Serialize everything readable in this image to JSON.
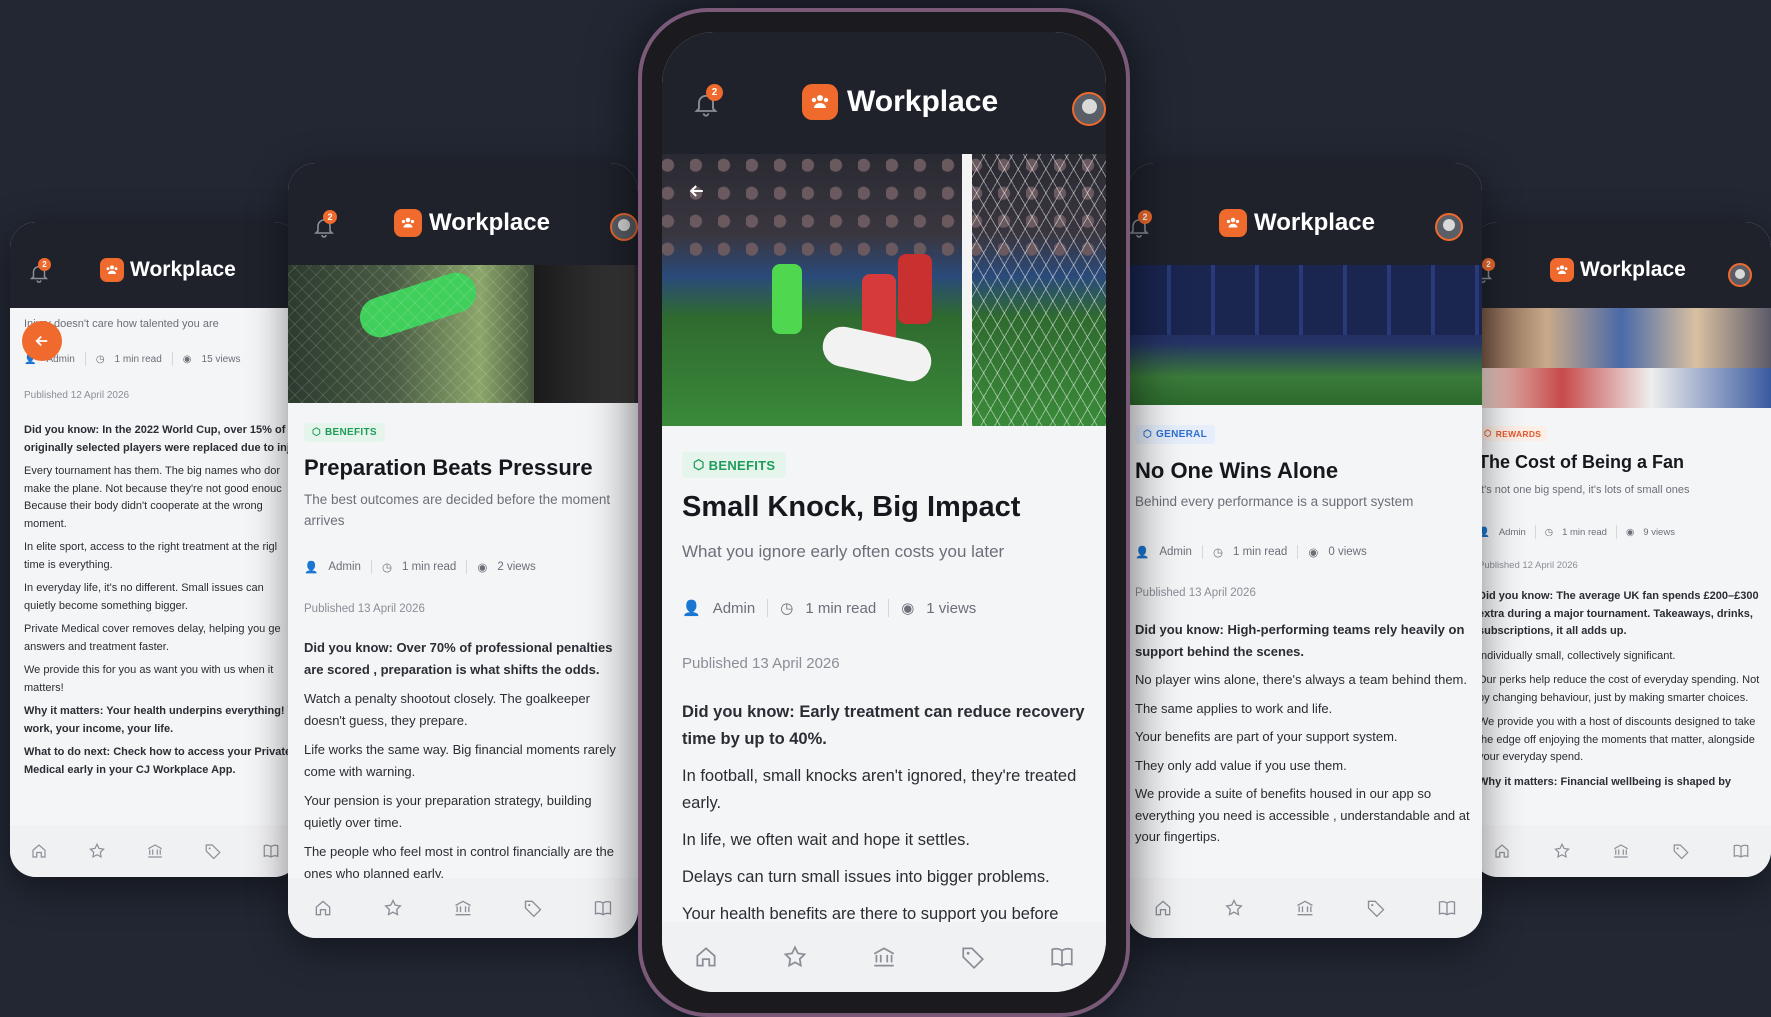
{
  "app_name": "Workplace",
  "notification_count": "2",
  "phones": {
    "p1": {
      "intro": "Injury doesn't care how talented you are",
      "author": "Admin",
      "read": "1 min read",
      "views": "15 views",
      "published": "Published 12 April 2026",
      "paras": [
        {
          "text": "Did you know: In the 2022 World Cup, over 15% of originally selected players were replaced due to inj",
          "bold": true
        },
        {
          "text": "Every tournament has them. The big names who dor make the plane. Not because they're not good enouc Because their body didn't cooperate at the wrong moment.",
          "bold": false
        },
        {
          "text": "In elite sport, access to the right treatment at the rigl time is everything.",
          "bold": false
        },
        {
          "text": "In everyday life, it's no different. Small issues can quietly become something bigger.",
          "bold": false
        },
        {
          "text": "Private Medical cover removes delay, helping you ge answers and treatment faster.",
          "bold": false
        },
        {
          "text": "We provide this for you as want you with us when it matters!",
          "bold": false
        },
        {
          "text": "Why it matters: Your health underpins everything! Y work, your income, your life.",
          "bold": true
        },
        {
          "text": "What to do next: Check how to access your Private Medical early in your CJ Workplace App.",
          "bold": true
        }
      ]
    },
    "p2": {
      "tag": "BENEFITS",
      "title": "Preparation Beats Pressure",
      "subtitle": "The best outcomes are decided before the moment arrives",
      "author": "Admin",
      "read": "1 min read",
      "views": "2 views",
      "published": "Published 13 April 2026",
      "paras": [
        {
          "text": "Did you know: Over 70% of professional penalties are scored , preparation is what shifts the odds.",
          "bold": true
        },
        {
          "text": "Watch a penalty shootout closely. The goalkeeper doesn't guess, they prepare.",
          "bold": false
        },
        {
          "text": "Life works the same way. Big financial moments rarely come with warning.",
          "bold": false
        },
        {
          "text": "Your pension is your preparation strategy, building quietly over time.",
          "bold": false
        },
        {
          "text": "The people who feel most in control financially are the ones who planned early.",
          "bold": false
        }
      ]
    },
    "p3": {
      "tag": "BENEFITS",
      "title": "Small Knock, Big Impact",
      "subtitle": "What you ignore early often costs you later",
      "author": "Admin",
      "read": "1 min read",
      "views": "1 views",
      "published": "Published 13 April 2026",
      "paras": [
        {
          "text": "Did you know: Early treatment can reduce recovery time by up to 40%.",
          "bold": true
        },
        {
          "text": "In football, small knocks aren't ignored, they're treated early.",
          "bold": false
        },
        {
          "text": "In life, we often wait and hope it settles.",
          "bold": false
        },
        {
          "text": "Delays can turn small issues into bigger problems.",
          "bold": false
        },
        {
          "text": "Your health benefits are there to support you before things escalate.",
          "bold": false
        }
      ]
    },
    "p4": {
      "tag": "GENERAL",
      "title": "No One Wins Alone",
      "subtitle": "Behind every performance is a support system",
      "author": "Admin",
      "read": "1 min read",
      "views": "0 views",
      "published": "Published 13 April 2026",
      "paras": [
        {
          "text": "Did you know: High-performing teams rely heavily on support behind the scenes.",
          "bold": true
        },
        {
          "text": "No player wins alone, there's always a team behind them.",
          "bold": false
        },
        {
          "text": "The same applies to work and life.",
          "bold": false
        },
        {
          "text": "Your benefits are part of your support system.",
          "bold": false
        },
        {
          "text": "They only add value if you use them.",
          "bold": false
        },
        {
          "text": "We provide a suite of benefits housed in our app so everything you need is accessible , understandable and at your fingertips.",
          "bold": false
        }
      ]
    },
    "p5": {
      "tag": "REWARDS",
      "title": "The Cost of Being a Fan",
      "subtitle": "It's not one big spend, it's lots of small ones",
      "author": "Admin",
      "read": "1 min read",
      "views": "9 views",
      "published": "Published 12 April 2026",
      "paras": [
        {
          "text": "Did you know: The average UK fan spends £200–£300 extra during a major tournament. Takeaways, drinks, subscriptions, it all adds up.",
          "bold": true
        },
        {
          "text": "Individually small, collectively significant.",
          "bold": false
        },
        {
          "text": "Our perks help reduce the cost of everyday spending. Not by changing behaviour, just by making smarter choices.",
          "bold": false
        },
        {
          "text": "We provide you with a host of discounts designed to take the edge off enjoying the moments that matter, alongside your everyday spend.",
          "bold": false
        },
        {
          "text": "Why it matters: Financial wellbeing is shaped by",
          "bold": true
        }
      ]
    }
  },
  "colors": {
    "accent": "#ef6a2c",
    "benefits_tag": "#1f9b5a",
    "general_tag": "#2f6fd1",
    "rewards_tag": "#e4582b",
    "header": "#1f222b",
    "background": "#222733"
  },
  "icons": [
    "bell-icon",
    "back-arrow-icon",
    "tag-icon",
    "person-icon",
    "clock-icon",
    "eye-icon",
    "home-icon",
    "star-icon",
    "bank-icon",
    "tag-nav-icon",
    "book-icon"
  ]
}
